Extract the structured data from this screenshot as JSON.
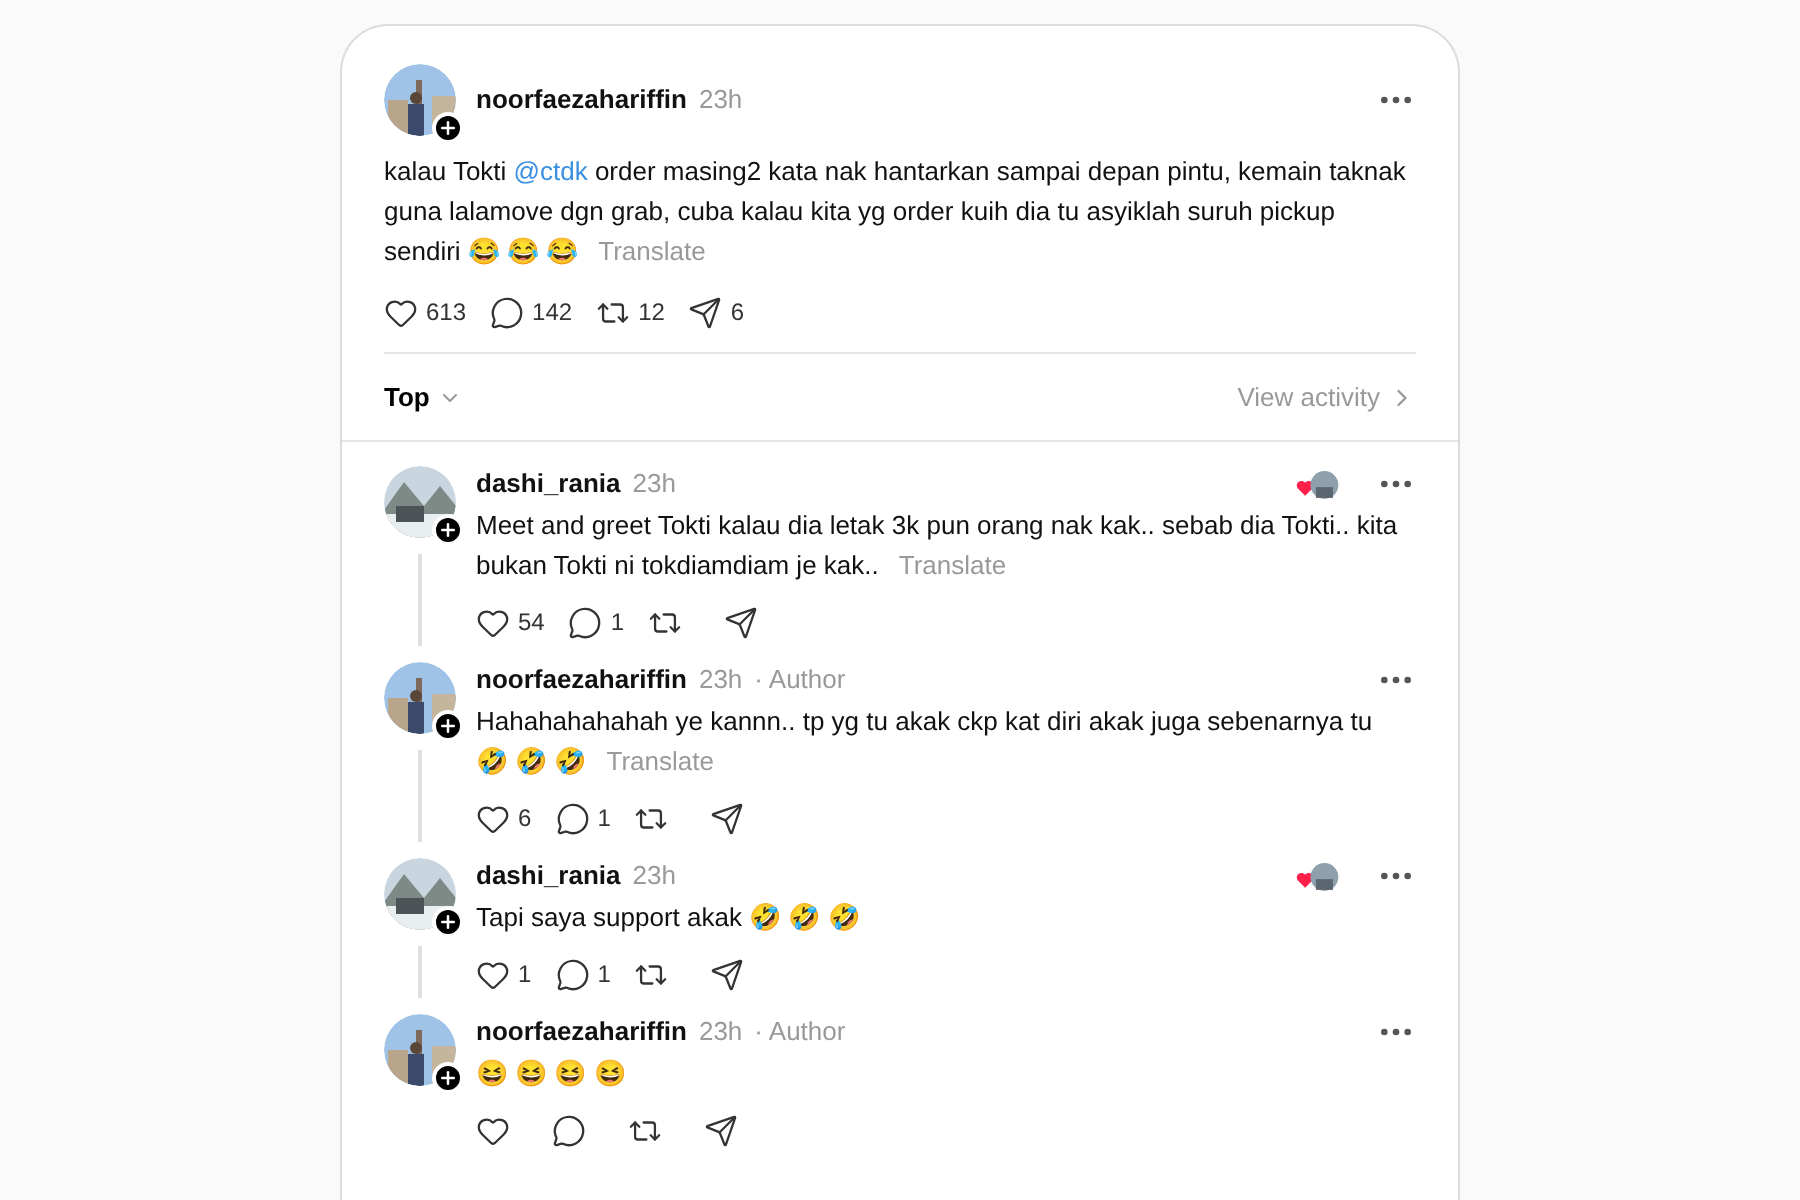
{
  "post": {
    "username": "noorfaezahariffin",
    "time": "23h",
    "text_parts": [
      {
        "kind": "text",
        "text": "kalau Tokti "
      },
      {
        "kind": "mention",
        "text": "@ctdk"
      },
      {
        "kind": "text",
        "text": " order masing2 kata nak hantarkan sampai depan pintu, kemain taknak guna lalamove dgn grab, cuba kalau kita yg order kuih dia tu asyiklah suruh pickup sendiri 😂 😂 😂"
      }
    ],
    "translate": "Translate",
    "actions": [
      {
        "kind": "like",
        "count": "613"
      },
      {
        "kind": "reply",
        "count": "142"
      },
      {
        "kind": "repost",
        "count": "12"
      },
      {
        "kind": "share",
        "count": "6"
      }
    ]
  },
  "sort": {
    "label": "Top",
    "activity": "View activity"
  },
  "comments": [
    {
      "username": "dashi_rania",
      "time": "23h",
      "text": "Meet and greet Tokti kalau dia letak 3k pun orang nak kak.. sebab dia Tokti.. kita bukan Tokti ni tokdiamdiam je kak..",
      "translate": "Translate",
      "liked_by_author": true,
      "thread_line": true,
      "actions": [
        {
          "kind": "like",
          "count": "54"
        },
        {
          "kind": "reply",
          "count": "1"
        },
        {
          "kind": "repost"
        },
        {
          "kind": "share"
        }
      ]
    },
    {
      "username": "noorfaezahariffin",
      "time": "23h",
      "author_tag": "· Author",
      "text": "Hahahahahahah ye kannn.. tp yg tu akak ckp kat diri akak juga sebenarnya tu 🤣 🤣 🤣",
      "translate": "Translate",
      "liked_by_author": false,
      "thread_line": true,
      "actions": [
        {
          "kind": "like",
          "count": "6"
        },
        {
          "kind": "reply",
          "count": "1"
        },
        {
          "kind": "repost"
        },
        {
          "kind": "share"
        }
      ]
    },
    {
      "username": "dashi_rania",
      "time": "23h",
      "text": "Tapi saya support akak 🤣 🤣 🤣",
      "liked_by_author": true,
      "thread_line": true,
      "actions": [
        {
          "kind": "like",
          "count": "1"
        },
        {
          "kind": "reply",
          "count": "1"
        },
        {
          "kind": "repost"
        },
        {
          "kind": "share"
        }
      ]
    },
    {
      "username": "noorfaezahariffin",
      "time": "23h",
      "author_tag": "· Author",
      "text": "😆 😆 😆 😆",
      "liked_by_author": false,
      "thread_line": false,
      "actions": [
        {
          "kind": "like"
        },
        {
          "kind": "reply"
        },
        {
          "kind": "repost"
        },
        {
          "kind": "share"
        }
      ]
    }
  ]
}
